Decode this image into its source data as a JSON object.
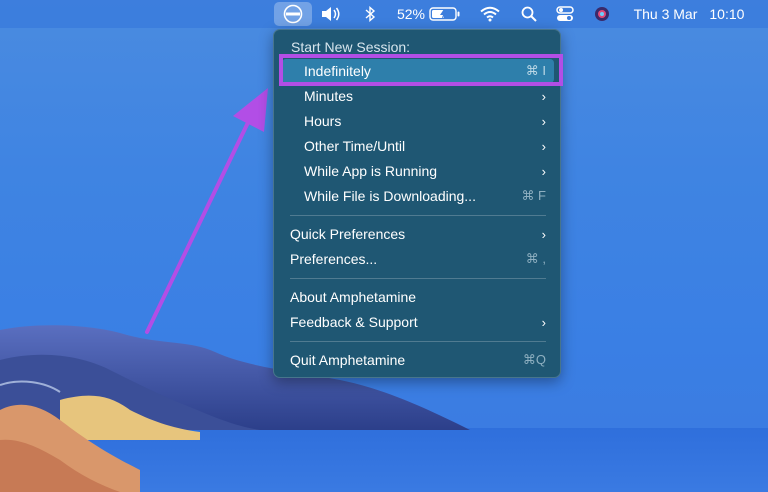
{
  "menubar": {
    "battery_percent": "52%",
    "date": "Thu 3 Mar",
    "time": "10:10",
    "icons": [
      "amphetamine-icon",
      "volume-icon",
      "bluetooth-icon",
      "battery-charging-icon",
      "wifi-icon",
      "search-icon",
      "control-center-icon",
      "siri-icon"
    ]
  },
  "menu": {
    "header": "Start New Session:",
    "items": [
      {
        "label": "Indefinitely",
        "shortcut": "⌘ I",
        "selected": true
      },
      {
        "label": "Minutes",
        "submenu": true
      },
      {
        "label": "Hours",
        "submenu": true
      },
      {
        "label": "Other Time/Until",
        "submenu": true
      },
      {
        "label": "While App is Running",
        "submenu": true
      },
      {
        "label": "While File is Downloading...",
        "shortcut": "⌘ F"
      },
      {
        "label": "Quick Preferences",
        "submenu": true
      },
      {
        "label": "Preferences...",
        "shortcut": "⌘ ,"
      },
      {
        "label": "About Amphetamine"
      },
      {
        "label": "Feedback & Support",
        "submenu": true
      },
      {
        "label": "Quit Amphetamine",
        "shortcut": "⌘Q"
      }
    ],
    "chevron": "›"
  },
  "colors": {
    "highlight": "#b24ee6",
    "menu_bg": "#1f5773",
    "selected_bg": "#2e7fab"
  }
}
